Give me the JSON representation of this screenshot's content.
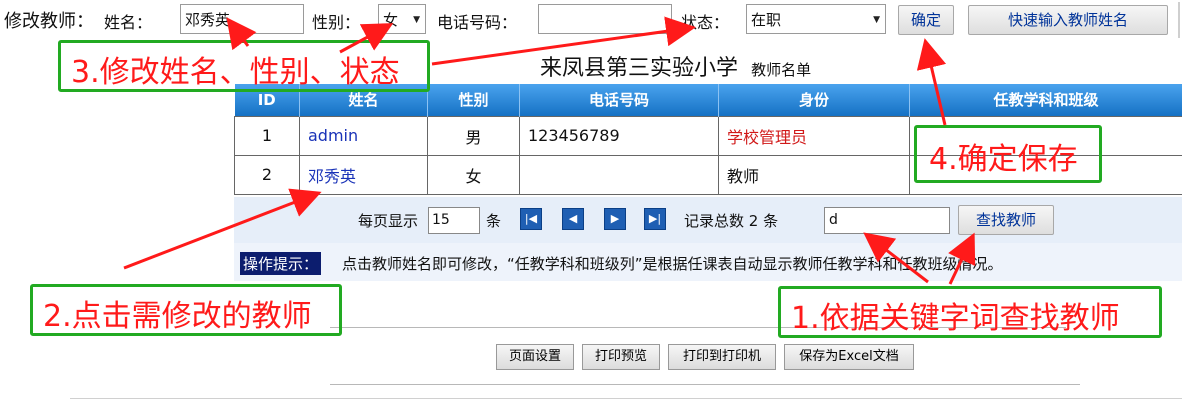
{
  "edit_bar": {
    "title": "修改教师：",
    "name_label": "姓名：",
    "name_value": "邓秀英",
    "gender_label": "性别：",
    "gender_value": "女",
    "phone_label": "电话号码：",
    "phone_value": "",
    "status_label": "状态：",
    "status_value": "在职",
    "confirm_label": "确定",
    "quick_input_label": "快速输入教师姓名"
  },
  "heading": {
    "school": "来凤县第三实验小学",
    "subtitle": "教师名单"
  },
  "table": {
    "columns": [
      "ID",
      "姓名",
      "性别",
      "电话号码",
      "身份",
      "任教学科和班级"
    ],
    "rows": [
      {
        "id": "1",
        "name": "admin",
        "gender": "男",
        "phone": "123456789",
        "role": "学校管理员",
        "subjects": ""
      },
      {
        "id": "2",
        "name": "邓秀英",
        "gender": "女",
        "phone": "",
        "role": "教师",
        "subjects": ""
      }
    ]
  },
  "pager": {
    "per_page_label": "每页显示",
    "per_page_value": "15",
    "unit": "条",
    "total_text": "记录总数 2 条",
    "search_value": "d",
    "search_button": "查找教师"
  },
  "tip": {
    "label": "操作提示：",
    "text": "点击教师姓名即可修改，“任教学科和班级列”是根据任课表自动显示教师任教学科和任教班级情况。"
  },
  "print_buttons": [
    "页面设置",
    "打印预览",
    "打印到打印机",
    "保存为Excel文档"
  ],
  "annotations": {
    "step1": "1.依据关键字词查找教师",
    "step2": "2.点击需修改的教师",
    "step3": "3.修改姓名、性别、状态",
    "step4": "4.确定保存"
  },
  "colors": {
    "header_blue": "#1571c4",
    "link_blue": "#1a33b8",
    "role_red": "#d11919",
    "annotation_red": "#ff1a1a",
    "annotation_green": "#22aa22"
  }
}
